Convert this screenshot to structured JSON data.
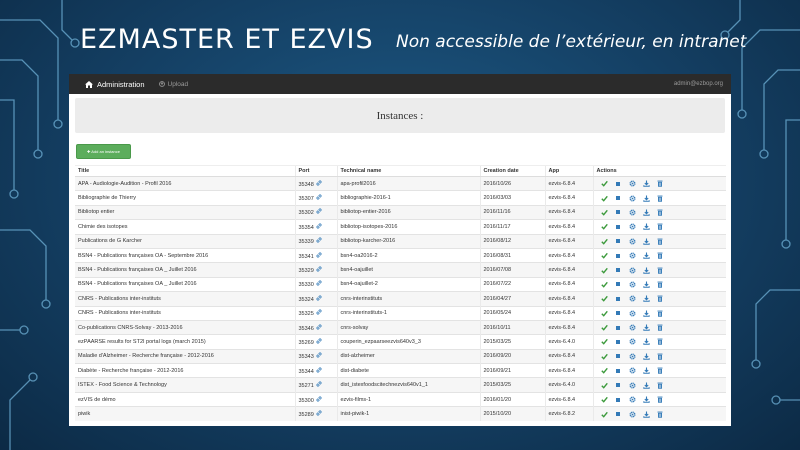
{
  "slide": {
    "title": "EZMASTER ET EZVIS",
    "subtitle": "Non accessible de l’extérieur, en intranet"
  },
  "navbar": {
    "brand": "Administration",
    "upload": "Upload",
    "user": "admin@ezbop.org"
  },
  "page": {
    "heading": "Instances :",
    "add_button": "✚ Add an instance"
  },
  "table": {
    "headers": [
      "Title",
      "Port",
      "Technical name",
      "Creation date",
      "App",
      "Actions"
    ],
    "rows": [
      {
        "title": "APA - Audiologie-Audition - Profil 2016",
        "port": "35348",
        "tech": "apa-profil2016",
        "date": "2016/10/26",
        "app": "ezvis-6.8.4"
      },
      {
        "title": "Bibliographie de Thierry",
        "port": "35307",
        "tech": "bibliographie-2016-1",
        "date": "2016/03/03",
        "app": "ezvis-6.8.4"
      },
      {
        "title": "Bibliotop entier",
        "port": "35302",
        "tech": "bibliotop-entier-2016",
        "date": "2016/11/16",
        "app": "ezvis-6.8.4"
      },
      {
        "title": "Chimie des isotopes",
        "port": "35354",
        "tech": "bibliotop-isotopes-2016",
        "date": "2016/11/17",
        "app": "ezvis-6.8.4"
      },
      {
        "title": "Publications de G Karcher",
        "port": "35339",
        "tech": "bibliotop-karcher-2016",
        "date": "2016/08/12",
        "app": "ezvis-6.8.4"
      },
      {
        "title": "BSN4 - Publications françaises OA - Septembre 2016",
        "port": "35341",
        "tech": "bsn4-oa2016-2",
        "date": "2016/08/31",
        "app": "ezvis-6.8.4"
      },
      {
        "title": "BSN4 - Publications françaises OA _ Juillet 2016",
        "port": "35329",
        "tech": "bsn4-oajuillet",
        "date": "2016/07/08",
        "app": "ezvis-6.8.4"
      },
      {
        "title": "BSN4 - Publications françaises OA _ Juillet 2016",
        "port": "35330",
        "tech": "bsn4-oajuillet-2",
        "date": "2016/07/22",
        "app": "ezvis-6.8.4"
      },
      {
        "title": "CNRS - Publications inter-instituts",
        "port": "35324",
        "tech": "cnrs-interinstituts",
        "date": "2016/04/27",
        "app": "ezvis-6.8.4"
      },
      {
        "title": "CNRS - Publications inter-instituts",
        "port": "35325",
        "tech": "cnrs-interinstituts-1",
        "date": "2016/05/24",
        "app": "ezvis-6.8.4"
      },
      {
        "title": "Co-publications CNRS-Solvay - 2013-2016",
        "port": "35346",
        "tech": "cnrs-solvay",
        "date": "2016/10/11",
        "app": "ezvis-6.8.4"
      },
      {
        "title": "ezPAARSE results for ST2I portal logs (march 2015)",
        "port": "35269",
        "tech": "couperin_ezpaarseezvis640v3_3",
        "date": "2015/03/25",
        "app": "ezvis-6.4.0"
      },
      {
        "title": "Maladie d'Alzheimer - Recherche française - 2012-2016",
        "port": "35343",
        "tech": "dist-alzheimer",
        "date": "2016/09/20",
        "app": "ezvis-6.8.4"
      },
      {
        "title": "Diabète - Recherche française - 2012-2016",
        "port": "35344",
        "tech": "dist-diabete",
        "date": "2016/09/21",
        "app": "ezvis-6.8.4"
      },
      {
        "title": "ISTEX - Food Science & Technology",
        "port": "35271",
        "tech": "dist_istexfoodscitechnezvis640v1_1",
        "date": "2015/03/25",
        "app": "ezvis-6.4.0"
      },
      {
        "title": "ezVIS de démo",
        "port": "35300",
        "tech": "ezvis-films-1",
        "date": "2016/01/20",
        "app": "ezvis-6.8.4"
      },
      {
        "title": "piwik",
        "port": "35289",
        "tech": "inist-piwik-1",
        "date": "2015/10/20",
        "app": "ezvis-6.8.2"
      }
    ]
  },
  "icons": {
    "check_color": "#3c9a3c",
    "action_color": "#337ab7"
  }
}
